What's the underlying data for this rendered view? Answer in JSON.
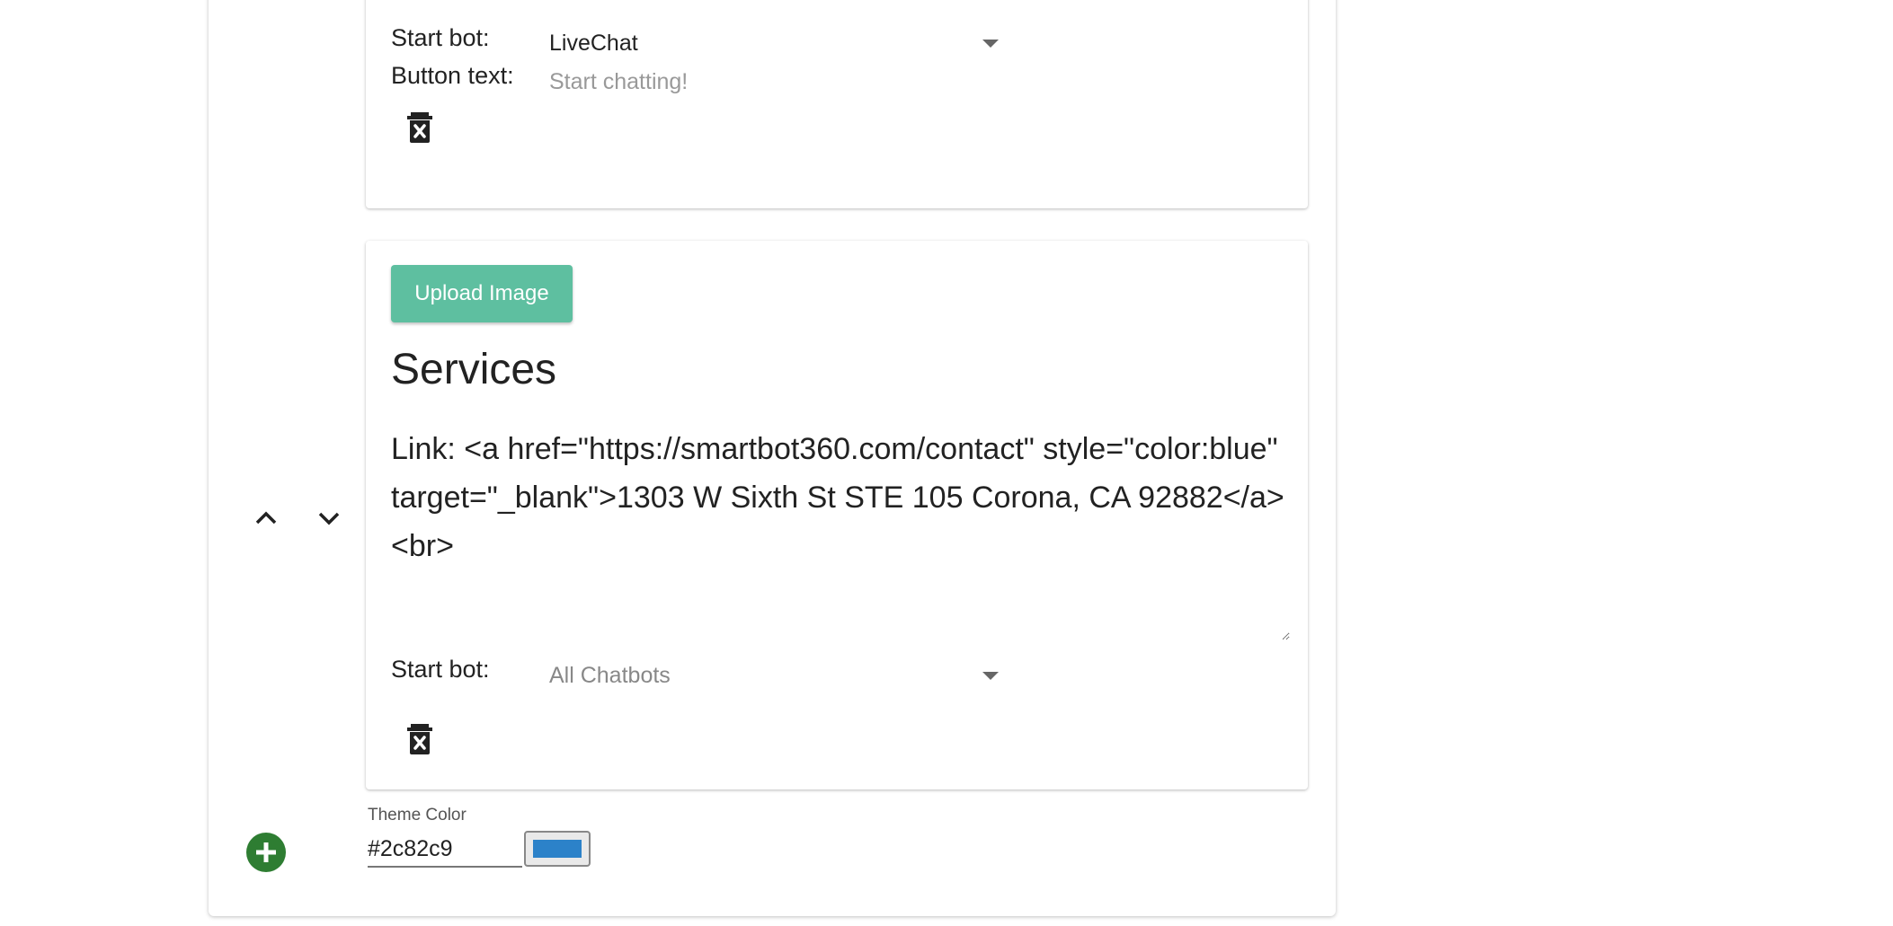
{
  "top_card": {
    "start_bot_label": "Start bot:",
    "start_bot_value": "LiveChat",
    "button_text_label": "Button text:",
    "button_text_placeholder": "Start chatting!"
  },
  "main_card": {
    "upload_label": "Upload Image",
    "title": "Services",
    "body_text": "Link: <a href=\"https://smartbot360.com/contact\" style=\"color:blue\" target=\"_blank\">1303 W Sixth St STE 105 Corona, CA 92882</a>\n<br>",
    "start_bot_label": "Start bot:",
    "start_bot_value": "All Chatbots"
  },
  "theme": {
    "label": "Theme Color",
    "value": "#2c82c9",
    "swatch_color": "#2c82c9"
  },
  "colors": {
    "upload_button": "#5ebfa0",
    "add_button": "#2e7d32"
  },
  "icons": {
    "delete": "trash-x-icon",
    "move_up": "chevron-up-icon",
    "move_down": "chevron-down-icon",
    "add": "plus-circle-icon"
  }
}
